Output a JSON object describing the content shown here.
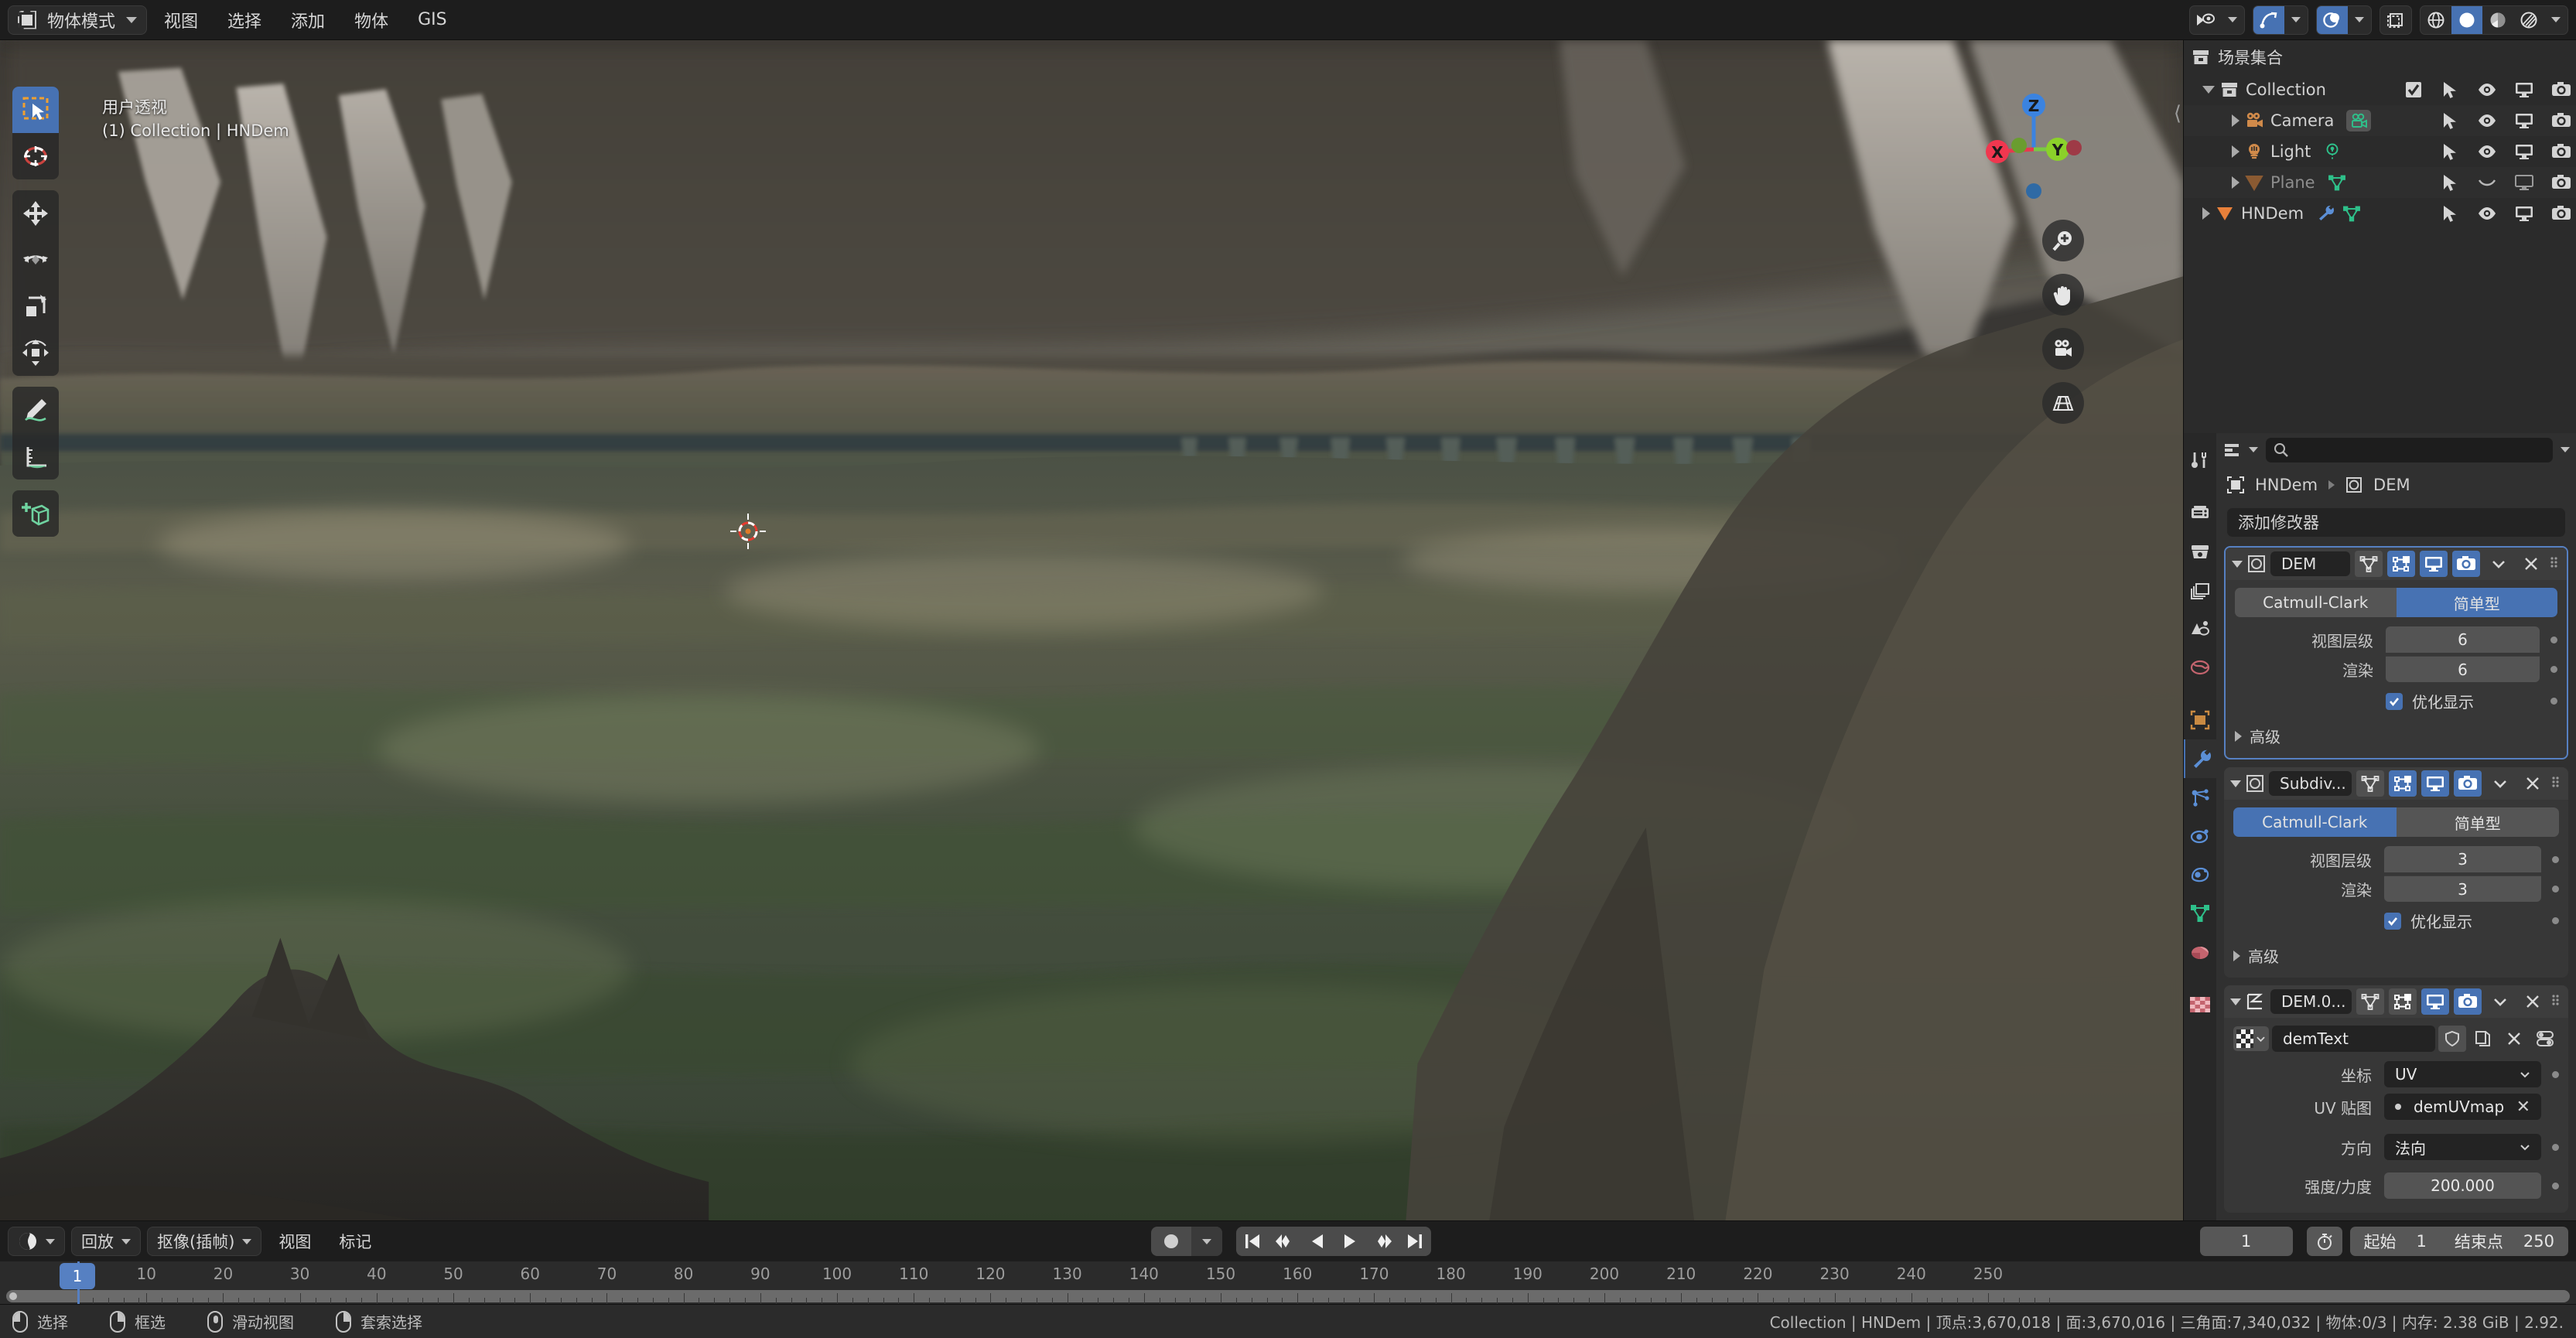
{
  "topbar": {
    "mode_label": "物体模式",
    "menus": [
      "视图",
      "选择",
      "添加",
      "物体",
      "GIS"
    ]
  },
  "viewport": {
    "perspective_label": "用户透视",
    "object_path_label": "(1) Collection | HNDem",
    "gizmo_axes": {
      "x": "X",
      "y": "Y",
      "z": "Z"
    },
    "tools": [
      "tweak-select-tool",
      "cursor-tool",
      "move-tool",
      "rotate-tool",
      "scale-tool",
      "transform-tool",
      "annotate-tool",
      "measure-tool",
      "add-cube-tool"
    ],
    "nav_buttons": [
      "zoom-icon",
      "pan-hand-icon",
      "camera-view-icon",
      "orthographic-grid-icon"
    ],
    "shading_modes": [
      "wireframe",
      "solid",
      "material-preview",
      "rendered"
    ],
    "active_shading_mode": "solid"
  },
  "outliner": {
    "title": "场景集合",
    "search_placeholder": "",
    "rows": [
      {
        "name": "Collection",
        "indent": 0,
        "icon": "collection-icon",
        "expanded": true,
        "checkbox": true,
        "dim": false,
        "hidden": false,
        "type": "collection"
      },
      {
        "name": "Camera",
        "indent": 1,
        "icon": "camera-icon",
        "expanded": false,
        "checkbox": false,
        "dim": false,
        "hidden": false,
        "type": "camera"
      },
      {
        "name": "Light",
        "indent": 1,
        "icon": "light-icon",
        "expanded": false,
        "checkbox": false,
        "dim": false,
        "hidden": false,
        "type": "light"
      },
      {
        "name": "Plane",
        "indent": 1,
        "icon": "mesh-icon",
        "expanded": false,
        "checkbox": false,
        "dim": true,
        "hidden": true,
        "type": "mesh"
      },
      {
        "name": "HNDem",
        "indent": 0,
        "icon": "mesh-icon",
        "expanded": false,
        "checkbox": false,
        "dim": false,
        "hidden": false,
        "type": "mesh-modifier"
      }
    ]
  },
  "properties": {
    "breadcrumb_object": "HNDem",
    "breadcrumb_data": "DEM",
    "add_modifier_label": "添加修改器",
    "tabs": [
      "tool-icon",
      "render-icon",
      "output-icon",
      "view-layer-icon",
      "scene-icon",
      "world-icon",
      "object-icon",
      "modifier-icon",
      "particles-icon",
      "physics-icon",
      "constraints-icon",
      "data-icon",
      "material-icon",
      "texture-icon"
    ],
    "active_tab": "modifier-icon",
    "modifiers": [
      {
        "name": "DEM",
        "icon": "subsurf-icon",
        "selected": true,
        "toggles": {
          "edit_mode": false,
          "cage": true,
          "realtime": true,
          "render": true
        },
        "seg_options": [
          "Catmull-Clark",
          "简单型"
        ],
        "seg_active": "简单型",
        "fields": [
          {
            "label": "视图层级",
            "value": "6"
          },
          {
            "label": "渲染",
            "value": "6"
          }
        ],
        "checkbox_label": "优化显示",
        "checkbox_checked": true,
        "advanced_label": "高级"
      },
      {
        "name": "Subdiv...",
        "icon": "subsurf-icon",
        "selected": false,
        "toggles": {
          "edit_mode": false,
          "cage": true,
          "realtime": true,
          "render": true
        },
        "seg_options": [
          "Catmull-Clark",
          "简单型"
        ],
        "seg_active": "Catmull-Clark",
        "fields": [
          {
            "label": "视图层级",
            "value": "3"
          },
          {
            "label": "渲染",
            "value": "3"
          }
        ],
        "checkbox_label": "优化显示",
        "checkbox_checked": true,
        "advanced_label": "高级"
      }
    ],
    "displace_modifier": {
      "name": "DEM.0...",
      "icon": "displace-icon",
      "toggles": {
        "edit_mode": false,
        "cage": false,
        "realtime": true,
        "render": true
      },
      "texture_name": "demText",
      "coords_label": "坐标",
      "coords_value": "UV",
      "uvmap_label": "UV 贴图",
      "uvmap_value": "demUVmap",
      "direction_label": "方向",
      "direction_value": "法向",
      "strength_label": "强度/力度",
      "strength_value": "200.000"
    }
  },
  "timeline": {
    "editor_label": "",
    "menus": [
      "回放",
      "抠像(插帧)",
      "视图",
      "标记"
    ],
    "current_frame": "1",
    "start_label": "起始",
    "start_value": "1",
    "end_label": "结束点",
    "end_value": "250",
    "tick_labels": [
      1,
      10,
      20,
      30,
      40,
      50,
      60,
      70,
      80,
      90,
      100,
      110,
      120,
      130,
      140,
      150,
      160,
      170,
      180,
      190,
      200,
      210,
      220,
      230,
      240,
      250
    ],
    "playhead_frame": 1
  },
  "statusbar": {
    "hints": [
      {
        "mouse": "lmb",
        "label": "选择"
      },
      {
        "mouse": "rmb",
        "label": "框选"
      },
      {
        "mouse": "mmb",
        "label": "滑动视图"
      },
      {
        "mouse": "rmb",
        "label": "套索选择"
      }
    ],
    "stats": "Collection | HNDem | 顶点:3,670,018 | 面:3,670,016 | 三角面:7,340,032 | 物体:0/3 | 内存: 2.38 GiB | 2.92."
  },
  "colors": {
    "accent": "#4772b3",
    "panel_bg": "#303030",
    "header_bg": "#1d1d1d",
    "outliner_bg": "#2b2b2b"
  }
}
